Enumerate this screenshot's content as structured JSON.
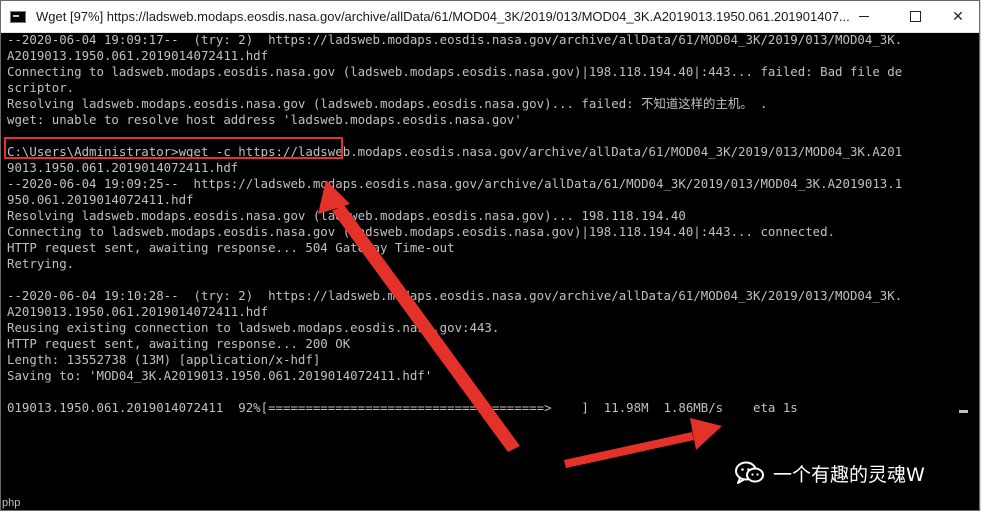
{
  "window": {
    "title": "Wget [97%] https://ladsweb.modaps.eosdis.nasa.gov/archive/allData/61/MOD04_3K/2019/013/MOD04_3K.A2019013.1950.061.201901407...",
    "min_glyph": "",
    "max_glyph": "",
    "close_glyph": "✕"
  },
  "console": {
    "lines": [
      "--2020-06-04 19:09:17--  (try: 2)  https://ladsweb.modaps.eosdis.nasa.gov/archive/allData/61/MOD04_3K/2019/013/MOD04_3K.",
      "A2019013.1950.061.2019014072411.hdf",
      "Connecting to ladsweb.modaps.eosdis.nasa.gov (ladsweb.modaps.eosdis.nasa.gov)|198.118.194.40|:443... failed: Bad file de",
      "scriptor.",
      "Resolving ladsweb.modaps.eosdis.nasa.gov (ladsweb.modaps.eosdis.nasa.gov)... failed: 不知道这样的主机。 .",
      "wget: unable to resolve host address 'ladsweb.modaps.eosdis.nasa.gov'",
      "",
      "C:\\Users\\Administrator>wget -c https://ladsweb.modaps.eosdis.nasa.gov/archive/allData/61/MOD04_3K/2019/013/MOD04_3K.A201",
      "9013.1950.061.2019014072411.hdf",
      "--2020-06-04 19:09:25--  https://ladsweb.modaps.eosdis.nasa.gov/archive/allData/61/MOD04_3K/2019/013/MOD04_3K.A2019013.1",
      "950.061.2019014072411.hdf",
      "Resolving ladsweb.modaps.eosdis.nasa.gov (ladsweb.modaps.eosdis.nasa.gov)... 198.118.194.40",
      "Connecting to ladsweb.modaps.eosdis.nasa.gov (ladsweb.modaps.eosdis.nasa.gov)|198.118.194.40|:443... connected.",
      "HTTP request sent, awaiting response... 504 Gateway Time-out",
      "Retrying.",
      "",
      "--2020-06-04 19:10:28--  (try: 2)  https://ladsweb.modaps.eosdis.nasa.gov/archive/allData/61/MOD04_3K/2019/013/MOD04_3K.",
      "A2019013.1950.061.2019014072411.hdf",
      "Reusing existing connection to ladsweb.modaps.eosdis.nasa.gov:443.",
      "HTTP request sent, awaiting response... 200 OK",
      "Length: 13552738 (13M) [application/x-hdf]",
      "Saving to: 'MOD04_3K.A2019013.1950.061.2019014072411.hdf'",
      "",
      "019013.1950.061.2019014072411  92%[=====================================>    ]  11.98M  1.86MB/s    eta 1s"
    ]
  },
  "watermark": {
    "text": "一个有趣的灵魂W"
  },
  "background": {
    "php_badge": "php"
  },
  "colors": {
    "console_bg": "#000000",
    "console_text": "#c0c0c0",
    "annotation_red": "#e4322b"
  },
  "icons": {
    "app": "console-icon",
    "minimize": "minimize-icon",
    "maximize": "maximize-icon",
    "close": "close-icon",
    "watermark": "wechat-icon"
  }
}
